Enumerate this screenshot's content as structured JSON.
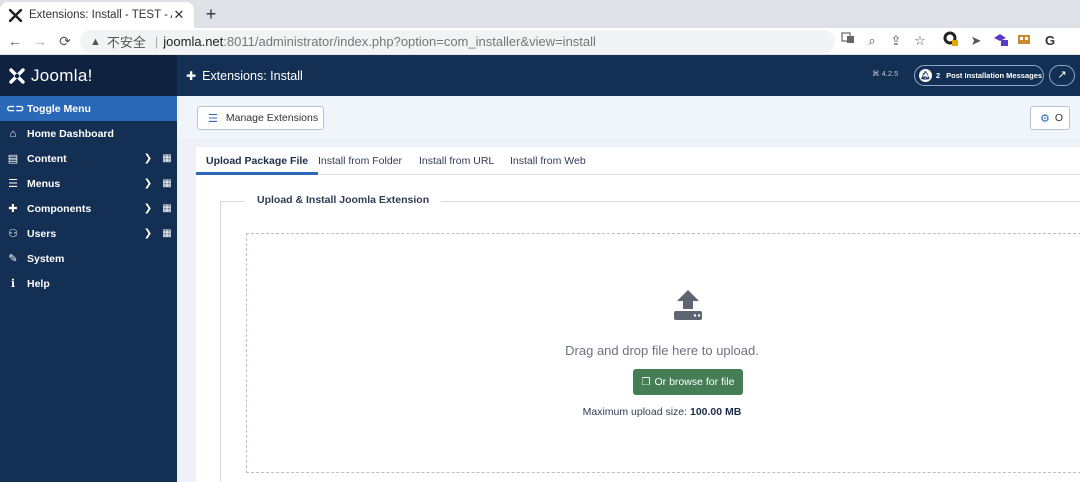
{
  "browser": {
    "tab_title": "Extensions: Install - TEST - Adr",
    "tab_close": "✕",
    "new_tab": "+",
    "nav": {
      "back": "←",
      "forward": "→",
      "reload": "⟳"
    },
    "insecure_label": "不安全",
    "url_host": "joomla.net",
    "url_path": ":8011/administrator/index.php?option=com_installer&view=install"
  },
  "sidebar": {
    "logo_text": "Joomla!",
    "items": [
      {
        "label": "Toggle Menu",
        "icon": "toggle-icon",
        "glyph": "⊂⊃",
        "active": true
      },
      {
        "label": "Home Dashboard",
        "icon": "home-icon",
        "glyph": "⌂"
      },
      {
        "label": "Content",
        "icon": "file-icon",
        "glyph": "▤",
        "chevron": "❯",
        "grid": "▦"
      },
      {
        "label": "Menus",
        "icon": "list-icon",
        "glyph": "☰",
        "chevron": "❯",
        "grid": "▦"
      },
      {
        "label": "Components",
        "icon": "puzzle-icon",
        "glyph": "✚",
        "chevron": "❯",
        "grid": "▦"
      },
      {
        "label": "Users",
        "icon": "users-icon",
        "glyph": "⚇",
        "chevron": "❯",
        "grid": "▦"
      },
      {
        "label": "System",
        "icon": "wrench-icon",
        "glyph": "✎"
      },
      {
        "label": "Help",
        "icon": "info-icon",
        "glyph": "ℹ"
      }
    ]
  },
  "header": {
    "title": "Extensions: Install",
    "version": "4.2.5",
    "notification_count": "2",
    "post_install_label": "Post Installation Messages"
  },
  "toolbar": {
    "manage_label": "Manage Extensions",
    "options_label": "O"
  },
  "tabs": [
    {
      "label": "Upload Package File",
      "selected": true
    },
    {
      "label": "Install from Folder"
    },
    {
      "label": "Install from URL"
    },
    {
      "label": "Install from Web"
    }
  ],
  "upload": {
    "legend": "Upload & Install Joomla Extension",
    "drop_text": "Drag and drop file here to upload.",
    "browse_label": "Or browse for file",
    "max_label": "Maximum upload size:",
    "max_value": "100.00 MB"
  },
  "colors": {
    "sidebar_bg": "#132f53",
    "active_item": "#2a69b8",
    "browse_button": "#457d54"
  }
}
